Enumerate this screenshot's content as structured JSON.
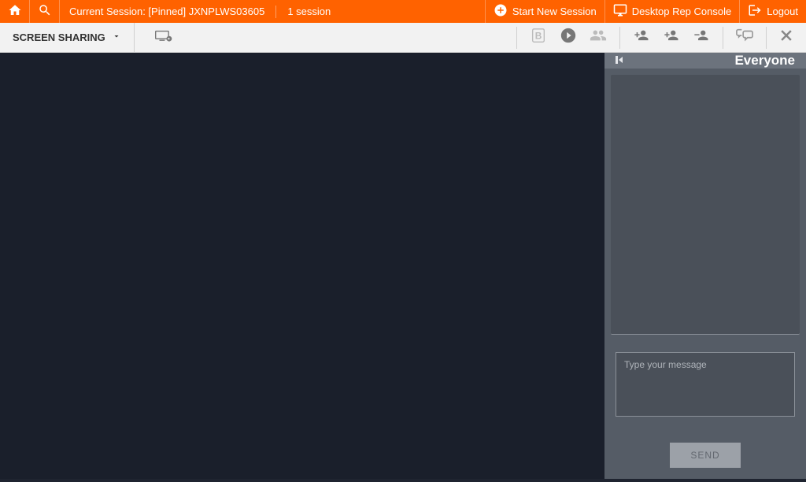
{
  "header": {
    "session_label": "Current Session: [Pinned] JXNPLWS03605",
    "session_count": "1 session",
    "start_new_session": "Start New Session",
    "desktop_rep_console": "Desktop Rep Console",
    "logout": "Logout"
  },
  "toolbar": {
    "mode_label": "SCREEN SHARING"
  },
  "chat": {
    "title": "Everyone",
    "input_placeholder": "Type your message",
    "send_label": "SEND"
  }
}
